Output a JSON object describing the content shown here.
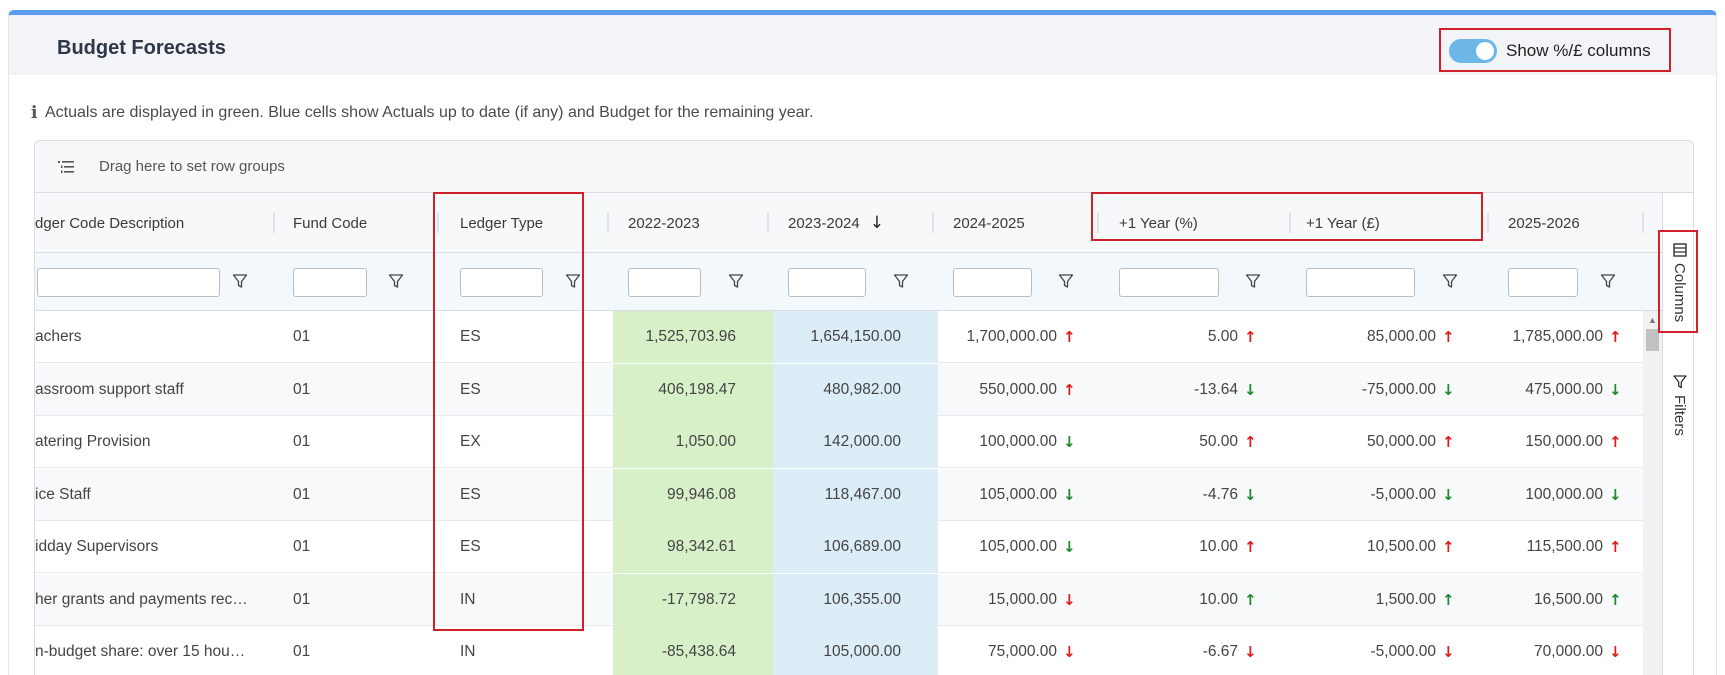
{
  "header": {
    "title": "Budget Forecasts",
    "toggle_label": "Show %/£ columns",
    "toggle_on": true
  },
  "info_text": "Actuals are displayed in green. Blue cells show Actuals up to date (if any) and Budget for the remaining year.",
  "grid": {
    "group_bar_text": "Drag here to set row groups",
    "columns": [
      {
        "key": "desc",
        "label": "dger Code Description"
      },
      {
        "key": "fund",
        "label": "Fund Code"
      },
      {
        "key": "ledger",
        "label": "Ledger Type"
      },
      {
        "key": "y2223",
        "label": "2022-2023"
      },
      {
        "key": "y2324",
        "label": "2023-2024",
        "sort": "desc"
      },
      {
        "key": "y2425",
        "label": "2024-2025"
      },
      {
        "key": "pct",
        "label": "+1 Year (%)"
      },
      {
        "key": "gbp",
        "label": "+1 Year (£)"
      },
      {
        "key": "y2526",
        "label": "2025-2026"
      }
    ],
    "rows": [
      {
        "desc": "achers",
        "fund": "01",
        "ledger": "ES",
        "y2223": "1,525,703.96",
        "y2324": "1,654,150.00",
        "y2425": "1,700,000.00",
        "y2425_arrow": "up",
        "pct": "5.00",
        "pct_arrow": "up",
        "gbp": "85,000.00",
        "gbp_arrow": "up",
        "y2526": "1,785,000.00",
        "y2526_arrow": "up"
      },
      {
        "desc": "assroom support staff",
        "fund": "01",
        "ledger": "ES",
        "y2223": "406,198.47",
        "y2324": "480,982.00",
        "y2425": "550,000.00",
        "y2425_arrow": "up",
        "pct": "-13.64",
        "pct_arrow": "down",
        "gbp": "-75,000.00",
        "gbp_arrow": "down",
        "y2526": "475,000.00",
        "y2526_arrow": "down"
      },
      {
        "desc": "atering Provision",
        "fund": "01",
        "ledger": "EX",
        "y2223": "1,050.00",
        "y2324": "142,000.00",
        "y2425": "100,000.00",
        "y2425_arrow": "down",
        "pct": "50.00",
        "pct_arrow": "up",
        "gbp": "50,000.00",
        "gbp_arrow": "up",
        "y2526": "150,000.00",
        "y2526_arrow": "up"
      },
      {
        "desc": "ice Staff",
        "fund": "01",
        "ledger": "ES",
        "y2223": "99,946.08",
        "y2324": "118,467.00",
        "y2425": "105,000.00",
        "y2425_arrow": "down",
        "pct": "-4.76",
        "pct_arrow": "down",
        "gbp": "-5,000.00",
        "gbp_arrow": "down",
        "y2526": "100,000.00",
        "y2526_arrow": "down"
      },
      {
        "desc": "idday Supervisors",
        "fund": "01",
        "ledger": "ES",
        "y2223": "98,342.61",
        "y2324": "106,689.00",
        "y2425": "105,000.00",
        "y2425_arrow": "down",
        "pct": "10.00",
        "pct_arrow": "up",
        "gbp": "10,500.00",
        "gbp_arrow": "up",
        "y2526": "115,500.00",
        "y2526_arrow": "up"
      },
      {
        "desc": "her grants and payments rec…",
        "fund": "01",
        "ledger": "IN",
        "y2223": "-17,798.72",
        "y2324": "106,355.00",
        "y2425": "15,000.00",
        "y2425_arrow": "down-red",
        "pct": "10.00",
        "pct_arrow": "up-green",
        "gbp": "1,500.00",
        "gbp_arrow": "up-green",
        "y2526": "16,500.00",
        "y2526_arrow": "up-green"
      },
      {
        "desc": "n-budget share: over 15 hou…",
        "fund": "01",
        "ledger": "IN",
        "y2223": "-85,438.64",
        "y2324": "105,000.00",
        "y2425": "75,000.00",
        "y2425_arrow": "down-red",
        "pct": "-6.67",
        "pct_arrow": "down-red",
        "gbp": "-5,000.00",
        "gbp_arrow": "down-red",
        "y2526": "70,000.00",
        "y2526_arrow": "down-red"
      }
    ]
  },
  "side_panel": {
    "columns_label": "Columns",
    "filters_label": "Filters"
  },
  "colors": {
    "accent": "#5b9def",
    "actuals_green": "#d8f0c8",
    "budget_blue": "#dcedf8",
    "highlight_red": "#d0202a",
    "arrow_up": "#e01b1b",
    "arrow_down": "#1e8a2e"
  }
}
